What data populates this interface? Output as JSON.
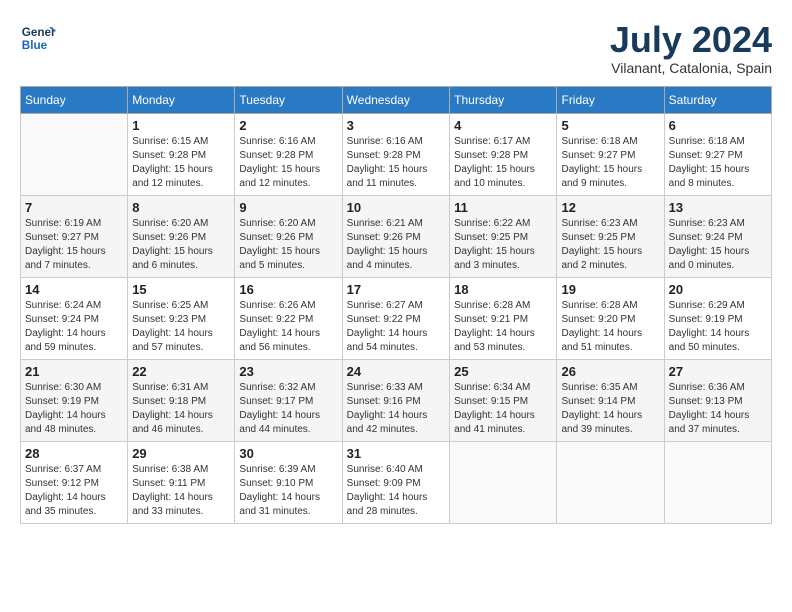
{
  "header": {
    "logo_line1": "General",
    "logo_line2": "Blue",
    "month_year": "July 2024",
    "location": "Vilanant, Catalonia, Spain"
  },
  "weekdays": [
    "Sunday",
    "Monday",
    "Tuesday",
    "Wednesday",
    "Thursday",
    "Friday",
    "Saturday"
  ],
  "weeks": [
    [
      {
        "day": "",
        "info": ""
      },
      {
        "day": "1",
        "info": "Sunrise: 6:15 AM\nSunset: 9:28 PM\nDaylight: 15 hours\nand 12 minutes."
      },
      {
        "day": "2",
        "info": "Sunrise: 6:16 AM\nSunset: 9:28 PM\nDaylight: 15 hours\nand 12 minutes."
      },
      {
        "day": "3",
        "info": "Sunrise: 6:16 AM\nSunset: 9:28 PM\nDaylight: 15 hours\nand 11 minutes."
      },
      {
        "day": "4",
        "info": "Sunrise: 6:17 AM\nSunset: 9:28 PM\nDaylight: 15 hours\nand 10 minutes."
      },
      {
        "day": "5",
        "info": "Sunrise: 6:18 AM\nSunset: 9:27 PM\nDaylight: 15 hours\nand 9 minutes."
      },
      {
        "day": "6",
        "info": "Sunrise: 6:18 AM\nSunset: 9:27 PM\nDaylight: 15 hours\nand 8 minutes."
      }
    ],
    [
      {
        "day": "7",
        "info": "Sunrise: 6:19 AM\nSunset: 9:27 PM\nDaylight: 15 hours\nand 7 minutes."
      },
      {
        "day": "8",
        "info": "Sunrise: 6:20 AM\nSunset: 9:26 PM\nDaylight: 15 hours\nand 6 minutes."
      },
      {
        "day": "9",
        "info": "Sunrise: 6:20 AM\nSunset: 9:26 PM\nDaylight: 15 hours\nand 5 minutes."
      },
      {
        "day": "10",
        "info": "Sunrise: 6:21 AM\nSunset: 9:26 PM\nDaylight: 15 hours\nand 4 minutes."
      },
      {
        "day": "11",
        "info": "Sunrise: 6:22 AM\nSunset: 9:25 PM\nDaylight: 15 hours\nand 3 minutes."
      },
      {
        "day": "12",
        "info": "Sunrise: 6:23 AM\nSunset: 9:25 PM\nDaylight: 15 hours\nand 2 minutes."
      },
      {
        "day": "13",
        "info": "Sunrise: 6:23 AM\nSunset: 9:24 PM\nDaylight: 15 hours\nand 0 minutes."
      }
    ],
    [
      {
        "day": "14",
        "info": "Sunrise: 6:24 AM\nSunset: 9:24 PM\nDaylight: 14 hours\nand 59 minutes."
      },
      {
        "day": "15",
        "info": "Sunrise: 6:25 AM\nSunset: 9:23 PM\nDaylight: 14 hours\nand 57 minutes."
      },
      {
        "day": "16",
        "info": "Sunrise: 6:26 AM\nSunset: 9:22 PM\nDaylight: 14 hours\nand 56 minutes."
      },
      {
        "day": "17",
        "info": "Sunrise: 6:27 AM\nSunset: 9:22 PM\nDaylight: 14 hours\nand 54 minutes."
      },
      {
        "day": "18",
        "info": "Sunrise: 6:28 AM\nSunset: 9:21 PM\nDaylight: 14 hours\nand 53 minutes."
      },
      {
        "day": "19",
        "info": "Sunrise: 6:28 AM\nSunset: 9:20 PM\nDaylight: 14 hours\nand 51 minutes."
      },
      {
        "day": "20",
        "info": "Sunrise: 6:29 AM\nSunset: 9:19 PM\nDaylight: 14 hours\nand 50 minutes."
      }
    ],
    [
      {
        "day": "21",
        "info": "Sunrise: 6:30 AM\nSunset: 9:19 PM\nDaylight: 14 hours\nand 48 minutes."
      },
      {
        "day": "22",
        "info": "Sunrise: 6:31 AM\nSunset: 9:18 PM\nDaylight: 14 hours\nand 46 minutes."
      },
      {
        "day": "23",
        "info": "Sunrise: 6:32 AM\nSunset: 9:17 PM\nDaylight: 14 hours\nand 44 minutes."
      },
      {
        "day": "24",
        "info": "Sunrise: 6:33 AM\nSunset: 9:16 PM\nDaylight: 14 hours\nand 42 minutes."
      },
      {
        "day": "25",
        "info": "Sunrise: 6:34 AM\nSunset: 9:15 PM\nDaylight: 14 hours\nand 41 minutes."
      },
      {
        "day": "26",
        "info": "Sunrise: 6:35 AM\nSunset: 9:14 PM\nDaylight: 14 hours\nand 39 minutes."
      },
      {
        "day": "27",
        "info": "Sunrise: 6:36 AM\nSunset: 9:13 PM\nDaylight: 14 hours\nand 37 minutes."
      }
    ],
    [
      {
        "day": "28",
        "info": "Sunrise: 6:37 AM\nSunset: 9:12 PM\nDaylight: 14 hours\nand 35 minutes."
      },
      {
        "day": "29",
        "info": "Sunrise: 6:38 AM\nSunset: 9:11 PM\nDaylight: 14 hours\nand 33 minutes."
      },
      {
        "day": "30",
        "info": "Sunrise: 6:39 AM\nSunset: 9:10 PM\nDaylight: 14 hours\nand 31 minutes."
      },
      {
        "day": "31",
        "info": "Sunrise: 6:40 AM\nSunset: 9:09 PM\nDaylight: 14 hours\nand 28 minutes."
      },
      {
        "day": "",
        "info": ""
      },
      {
        "day": "",
        "info": ""
      },
      {
        "day": "",
        "info": ""
      }
    ]
  ]
}
